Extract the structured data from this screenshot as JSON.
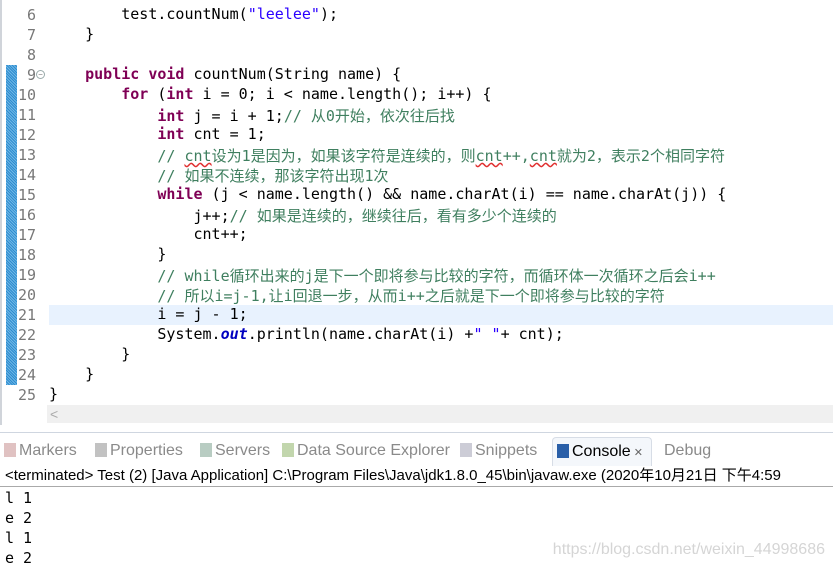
{
  "editor": {
    "first_line": 6,
    "current_line": 21,
    "lines": [
      [
        [
          "",
          "        test.countNum("
        ],
        [
          "str",
          "\"leelee\""
        ],
        [
          "",
          ");"
        ]
      ],
      [
        [
          "",
          "    }"
        ]
      ],
      [
        [
          "",
          ""
        ]
      ],
      [
        [
          "",
          "    "
        ],
        [
          "kw",
          "public"
        ],
        [
          "",
          " "
        ],
        [
          "kw",
          "void"
        ],
        [
          "",
          " countNum(String name) {"
        ]
      ],
      [
        [
          "",
          "        "
        ],
        [
          "kw",
          "for"
        ],
        [
          "",
          " ("
        ],
        [
          "kw",
          "int"
        ],
        [
          "",
          " i = 0; i < name.length(); i++) {"
        ]
      ],
      [
        [
          "",
          "            "
        ],
        [
          "kw",
          "int"
        ],
        [
          "",
          " j = i + 1;"
        ],
        [
          "cm",
          "// 从0开始，依次往后找"
        ]
      ],
      [
        [
          "",
          "            "
        ],
        [
          "kw",
          "int"
        ],
        [
          "",
          " cnt = 1;"
        ]
      ],
      [
        [
          "",
          "            "
        ],
        [
          "cm",
          "// "
        ],
        [
          "cmsq",
          "cnt"
        ],
        [
          "cm",
          "设为1是因为，如果该字符是连续的，则"
        ],
        [
          "cmsq",
          "cnt"
        ],
        [
          "cm",
          "++,"
        ],
        [
          "cmsq",
          "cnt"
        ],
        [
          "cm",
          "就为2，表示2个相同字符"
        ]
      ],
      [
        [
          "",
          "            "
        ],
        [
          "cm",
          "// 如果不连续，那该字符出现1次"
        ]
      ],
      [
        [
          "",
          "            "
        ],
        [
          "kw",
          "while"
        ],
        [
          "",
          " (j < name.length() && name.charAt(i) == name.charAt(j)) {"
        ]
      ],
      [
        [
          "",
          "                j++;"
        ],
        [
          "cm",
          "// 如果是连续的，继续往后，看有多少个连续的"
        ]
      ],
      [
        [
          "",
          "                cnt++;"
        ]
      ],
      [
        [
          "",
          "            }"
        ]
      ],
      [
        [
          "",
          "            "
        ],
        [
          "cm",
          "// while循环出来的j是下一个即将参与比较的字符，而循环体一次循环之后会i++"
        ]
      ],
      [
        [
          "",
          "            "
        ],
        [
          "cm",
          "// 所以i=j-1,让i回退一步，从而i++之后就是下一个即将参与比较的字符"
        ]
      ],
      [
        [
          "",
          "            i = j - 1;"
        ]
      ],
      [
        [
          "",
          "            System."
        ],
        [
          "fld",
          "out"
        ],
        [
          "",
          ".println(name.charAt(i) +"
        ],
        [
          "str",
          "\" \""
        ],
        [
          "",
          "+ cnt);"
        ]
      ],
      [
        [
          "",
          "        }"
        ]
      ],
      [
        [
          "",
          "    }"
        ]
      ],
      [
        [
          "",
          "}"
        ]
      ]
    ],
    "fold_icon": "minus-circle-icon",
    "scroll_left": "<"
  },
  "tabs": [
    {
      "label": "Markers",
      "icon": "markers-icon"
    },
    {
      "label": "Properties",
      "icon": "properties-icon"
    },
    {
      "label": "Servers",
      "icon": "servers-icon"
    },
    {
      "label": "Data Source Explorer",
      "icon": "data-source-icon"
    },
    {
      "label": "Snippets",
      "icon": "snippets-icon"
    },
    {
      "label": "Console",
      "icon": "console-icon",
      "active": true,
      "close": "✕"
    },
    {
      "label": "Debug"
    }
  ],
  "console": {
    "status": "<terminated> Test (2) [Java Application] C:\\Program Files\\Java\\jdk1.8.0_45\\bin\\javaw.exe (2020年10月21日 下午4:59",
    "output": [
      "l 1",
      "e 2",
      "l 1",
      "e 2"
    ]
  },
  "watermark": "https://blog.csdn.net/weixin_44998686"
}
